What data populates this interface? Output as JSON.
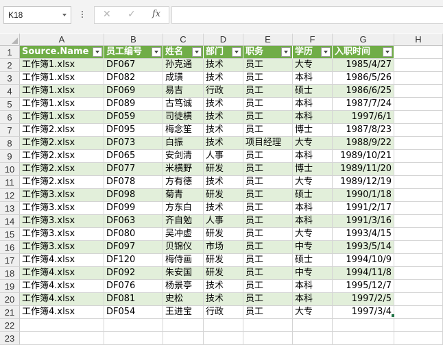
{
  "name_box": "K18",
  "formula_icons": {
    "cancel": "✕",
    "enter": "✓",
    "fx": "fx"
  },
  "formula_value": "",
  "columns": [
    "A",
    "B",
    "C",
    "D",
    "E",
    "F",
    "G",
    "H"
  ],
  "rows": [
    "1",
    "2",
    "3",
    "4",
    "5",
    "6",
    "7",
    "8",
    "9",
    "10",
    "11",
    "12",
    "13",
    "14",
    "15",
    "16",
    "17",
    "18",
    "19",
    "20",
    "21",
    "22",
    "23"
  ],
  "table": {
    "headers": [
      "Source.Name",
      "员工编号",
      "姓名",
      "部门",
      "职务",
      "学历",
      "入职时间"
    ],
    "rows": [
      [
        "工作簿1.xlsx",
        "DF067",
        "孙克通",
        "技术",
        "员工",
        "大专",
        "1985/4/27"
      ],
      [
        "工作簿1.xlsx",
        "DF082",
        "成璜",
        "技术",
        "员工",
        "本科",
        "1986/5/26"
      ],
      [
        "工作簿1.xlsx",
        "DF069",
        "易吉",
        "行政",
        "员工",
        "硕士",
        "1986/6/25"
      ],
      [
        "工作簿1.xlsx",
        "DF089",
        "古笃诚",
        "技术",
        "员工",
        "本科",
        "1987/7/24"
      ],
      [
        "工作簿1.xlsx",
        "DF059",
        "司徒横",
        "技术",
        "员工",
        "本科",
        "1997/6/1"
      ],
      [
        "工作簿2.xlsx",
        "DF095",
        "梅念笙",
        "技术",
        "员工",
        "博士",
        "1987/8/23"
      ],
      [
        "工作簿2.xlsx",
        "DF073",
        "白振",
        "技术",
        "项目经理",
        "大专",
        "1988/9/22"
      ],
      [
        "工作簿2.xlsx",
        "DF065",
        "安剑清",
        "人事",
        "员工",
        "本科",
        "1989/10/21"
      ],
      [
        "工作簿2.xlsx",
        "DF077",
        "米横野",
        "研发",
        "员工",
        "博士",
        "1989/11/20"
      ],
      [
        "工作簿2.xlsx",
        "DF078",
        "方有德",
        "技术",
        "员工",
        "大专",
        "1989/12/19"
      ],
      [
        "工作簿3.xlsx",
        "DF098",
        "菊青",
        "研发",
        "员工",
        "硕士",
        "1990/1/18"
      ],
      [
        "工作簿3.xlsx",
        "DF099",
        "方东白",
        "技术",
        "员工",
        "本科",
        "1991/2/17"
      ],
      [
        "工作簿3.xlsx",
        "DF063",
        "齐自勉",
        "人事",
        "员工",
        "本科",
        "1991/3/16"
      ],
      [
        "工作簿3.xlsx",
        "DF080",
        "吴冲虚",
        "研发",
        "员工",
        "大专",
        "1993/4/15"
      ],
      [
        "工作簿3.xlsx",
        "DF097",
        "贝锦仪",
        "市场",
        "员工",
        "中专",
        "1993/5/14"
      ],
      [
        "工作簿4.xlsx",
        "DF120",
        "梅侍画",
        "研发",
        "员工",
        "硕士",
        "1994/10/9"
      ],
      [
        "工作簿4.xlsx",
        "DF092",
        "朱安国",
        "研发",
        "员工",
        "中专",
        "1994/11/8"
      ],
      [
        "工作簿4.xlsx",
        "DF076",
        "杨景亭",
        "技术",
        "员工",
        "本科",
        "1995/12/7"
      ],
      [
        "工作簿4.xlsx",
        "DF081",
        "史松",
        "技术",
        "员工",
        "本科",
        "1997/2/5"
      ],
      [
        "工作簿4.xlsx",
        "DF054",
        "王进宝",
        "行政",
        "员工",
        "大专",
        "1997/3/4"
      ]
    ]
  },
  "colors": {
    "header_green": "#70ad47",
    "band_green": "#e2efda",
    "gridline": "#d4d4d4"
  }
}
